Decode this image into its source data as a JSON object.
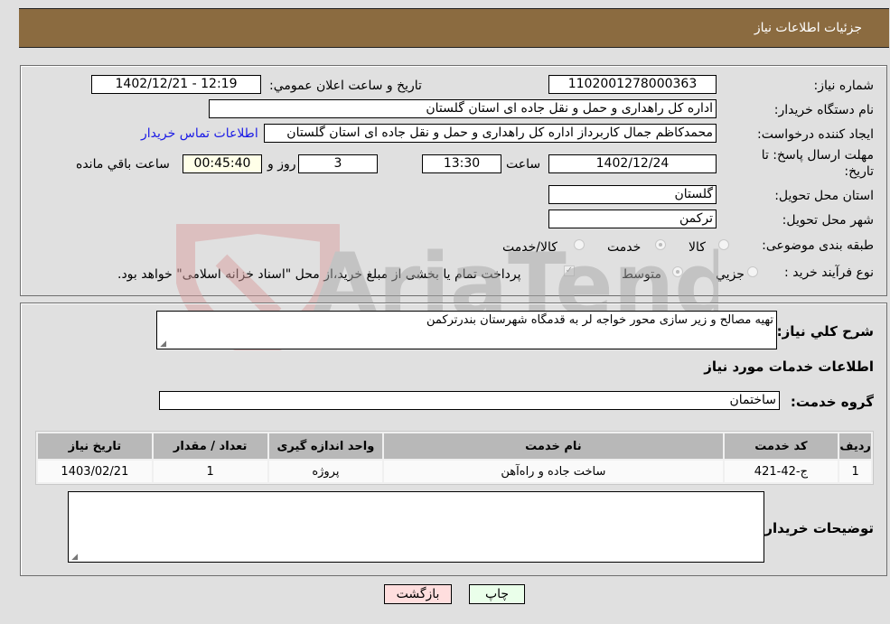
{
  "header": {
    "title": "جزئیات اطلاعات نیاز"
  },
  "form": {
    "need_number": {
      "label": "شماره نیاز:",
      "value": "1102001278000363"
    },
    "announce_datetime": {
      "label": "تاریخ و ساعت اعلان عمومي:",
      "value": "1402/12/21 - 12:19"
    },
    "buyer_org": {
      "label": "نام دستگاه خریدار:",
      "value": "اداره کل راهداری و حمل و نقل جاده ای استان گلستان"
    },
    "requester": {
      "label": "ایجاد کننده درخواست:",
      "value": "محمدکاظم جمال کاربرداز اداره کل راهداری و حمل و نقل جاده ای استان گلستان",
      "contact_link": "اطلاعات تماس خریدار"
    },
    "deadline": {
      "label": "مهلت ارسال پاسخ: تا تاریخ:",
      "date": "1402/12/24",
      "time_label": "ساعت",
      "time": "13:30",
      "days": "3",
      "days_label": "روز و",
      "remaining": "00:45:40",
      "remaining_label": "ساعت باقي مانده"
    },
    "delivery_province": {
      "label": "استان محل تحویل:",
      "value": "گلستان"
    },
    "delivery_city": {
      "label": "شهر محل تحویل:",
      "value": "ترکمن"
    },
    "category": {
      "label": "طبقه بندی موضوعی:",
      "options": [
        "کالا",
        "خدمت",
        "کالا/خدمت"
      ],
      "selected": "خدمت"
    },
    "purchase_type": {
      "label": "نوع فرآیند خرید :",
      "options": [
        "جزيي",
        "متوسط"
      ],
      "selected": "متوسط",
      "treasury_note": "پرداخت تمام یا بخشی از مبلغ خرید،از محل \"اسناد خزانه اسلامی\" خواهد بود."
    }
  },
  "details": {
    "description_label": "شرح کلي نیاز:",
    "description": "تهیه مصالح و زیر سازی محور خواجه لر به قدمگاه شهرستان بندرترکمن",
    "services_heading": "اطلاعات خدمات مورد نیاز",
    "service_group_label": "گروه خدمت:",
    "service_group": "ساختمان",
    "table": {
      "headers": [
        "ردیف",
        "کد خدمت",
        "نام خدمت",
        "واحد اندازه گیری",
        "تعداد / مقدار",
        "تاریخ نیاز"
      ],
      "rows": [
        [
          "1",
          "ج-42-421",
          "ساخت جاده و راه‌آهن",
          "پروژه",
          "1",
          "1403/02/21"
        ]
      ]
    },
    "buyer_notes_label": "توضیحات خریدار:",
    "buyer_notes": ""
  },
  "buttons": {
    "print": "چاپ",
    "back": "بازگشت"
  },
  "watermark": {
    "text": "AriaTender.net",
    "red": "#d9a0a0",
    "gray": "#a8a8a8"
  }
}
